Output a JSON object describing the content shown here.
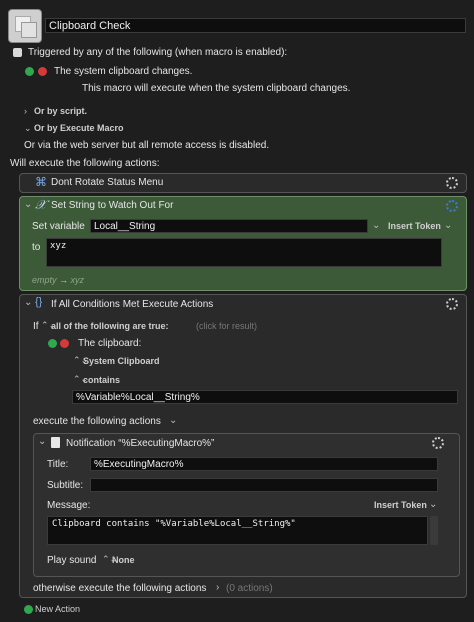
{
  "macro": {
    "name": "Clipboard Check"
  },
  "trigger": {
    "checkbox_label": "Triggered by any of the following (when macro is enabled):",
    "item": "The system clipboard changes.",
    "description": "This macro will execute when the system clipboard changes."
  },
  "options": {
    "or_script": "Or by script.",
    "or_execute": "Or by Execute Macro",
    "web": "Or via the web server but all remote access is disabled."
  },
  "actions_header": "Will execute the following actions:",
  "action1": {
    "title": "Dont Rotate Status Menu"
  },
  "action2": {
    "title": "Set String to Watch Out For",
    "set_variable_label": "Set variable",
    "variable_name": "Local__String",
    "insert_token": "Insert Token",
    "to_label": "to",
    "value": "xyz",
    "preview_empty": "empty",
    "preview_arrow": "→",
    "preview_value": "xyz"
  },
  "action3": {
    "title": "If All Conditions Met Execute Actions",
    "if_label": "If",
    "condition_mode": "all of the following are true:",
    "click_hint": "(click for result)",
    "clipboard_label": "The clipboard:",
    "clipboard_source": "System Clipboard",
    "operator": "contains",
    "match_value": "%Variable%Local__String%",
    "execute_label": "execute the following actions",
    "otherwise_label": "otherwise execute the following actions",
    "otherwise_count": "(0 actions)"
  },
  "notification": {
    "header": "Notification “%ExecutingMacro%”",
    "title_label": "Title:",
    "title_value": "%ExecutingMacro%",
    "subtitle_label": "Subtitle:",
    "subtitle_value": "",
    "message_label": "Message:",
    "insert_token": "Insert Token",
    "message_value": "Clipboard contains \"%Variable%Local__String%\"",
    "play_sound_label": "Play sound",
    "play_sound_value": "None"
  },
  "footer": {
    "new_action": "New Action"
  },
  "colors": {
    "accent_green": "#2fa84f",
    "set_variable_bg": "#3c5a38",
    "gear_blue": "#3d7bd9"
  }
}
